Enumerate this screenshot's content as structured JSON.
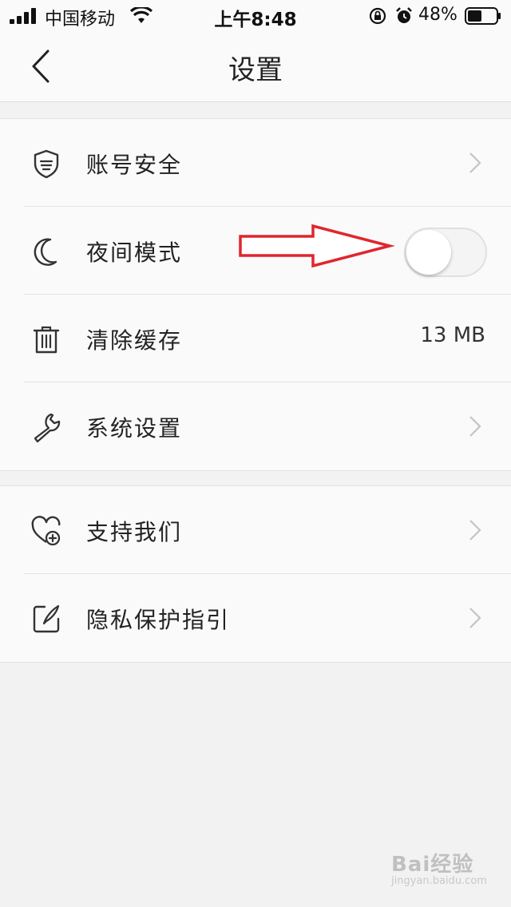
{
  "status_bar": {
    "carrier": "中国移动",
    "time": "上午8:48",
    "battery_percent": "48%"
  },
  "nav": {
    "title": "设置"
  },
  "group1": [
    {
      "label": "账号安全",
      "icon": "shield-icon",
      "trailing": "chevron"
    },
    {
      "label": "夜间模式",
      "icon": "moon-icon",
      "trailing": "toggle",
      "toggle_on": false
    },
    {
      "label": "清除缓存",
      "icon": "trash-icon",
      "trailing": "value",
      "value": "13 MB"
    },
    {
      "label": "系统设置",
      "icon": "wrench-icon",
      "trailing": "chevron"
    }
  ],
  "group2": [
    {
      "label": "支持我们",
      "icon": "heart-plus-icon",
      "trailing": "chevron"
    },
    {
      "label": "隐私保护指引",
      "icon": "edit-note-icon",
      "trailing": "chevron"
    }
  ],
  "annotation": {
    "color": "#e0262e"
  },
  "watermark": {
    "main": "Bai经验",
    "sub": "jingyan.baidu.com"
  }
}
